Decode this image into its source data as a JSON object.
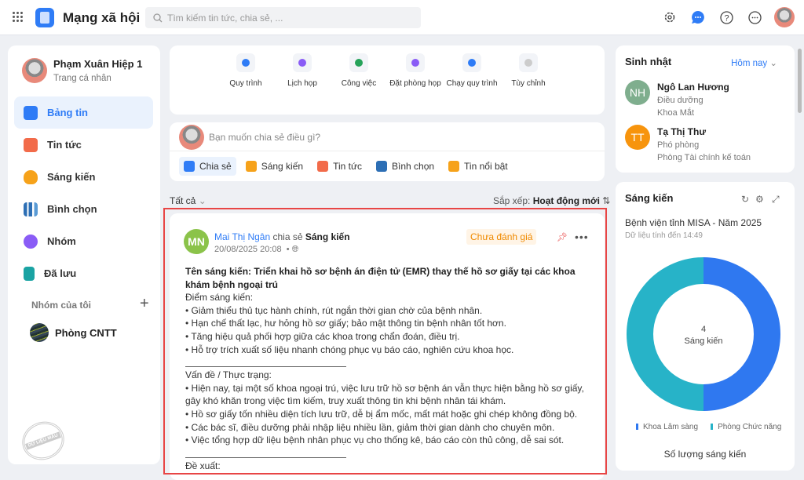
{
  "header": {
    "app_title": "Mạng xã hội",
    "search_placeholder": "Tìm kiếm tin tức, chia sẻ, ..."
  },
  "profile": {
    "name": "Phạm Xuân Hiệp 1",
    "subtitle": "Trang cá nhân"
  },
  "nav": [
    {
      "label": "Bảng tin",
      "color": "#2f7cf6"
    },
    {
      "label": "Tin tức",
      "color": "#f26b4a"
    },
    {
      "label": "Sáng kiến",
      "color": "#f6a21a"
    },
    {
      "label": "Bình chọn",
      "color": "#2d6fb5"
    },
    {
      "label": "Nhóm",
      "color": "#8a5cf6"
    },
    {
      "label": "Đã lưu",
      "color": "#1aa3a3"
    }
  ],
  "groups": {
    "heading": "Nhóm của tôi",
    "items": [
      "Phòng CNTT"
    ]
  },
  "watermark": "DỮ LIỆU MẪU",
  "shortcuts": [
    {
      "label": "Quy trình",
      "color": "#2f7cf6"
    },
    {
      "label": "Lịch họp",
      "color": "#8a5cf6"
    },
    {
      "label": "Công việc",
      "color": "#27a35a"
    },
    {
      "label": "Đặt phòng họp",
      "color": "#8a5cf6"
    },
    {
      "label": "Chạy quy trình",
      "color": "#2f7cf6"
    },
    {
      "label": "Tùy chỉnh",
      "color": "#ccc"
    }
  ],
  "composer": {
    "placeholder": "Bạn muốn chia sẻ điều gì?",
    "actions": [
      {
        "label": "Chia sẻ",
        "color": "#2f7cf6"
      },
      {
        "label": "Sáng kiến",
        "color": "#f6a21a"
      },
      {
        "label": "Tin tức",
        "color": "#f26b4a"
      },
      {
        "label": "Bình chọn",
        "color": "#2d6fb5"
      },
      {
        "label": "Tin nổi bật",
        "color": "#f6a21a"
      }
    ]
  },
  "feed": {
    "filter": "Tất cả",
    "sort_label": "Sắp xếp:",
    "sort_value": "Hoạt động mới"
  },
  "post": {
    "initials": "MN",
    "author": "Mai Thị Ngân",
    "verb": "chia sẻ",
    "type": "Sáng kiến",
    "time": "20/08/2025 20:08",
    "status": "Chưa đánh giá",
    "title": "Tên sáng kiến: Triển khai hồ sơ bệnh án điện tử (EMR) thay thế hồ sơ giấy tại các khoa khám bệnh ngoại trú",
    "points_heading": "Điểm sáng kiến:",
    "points": [
      "• Giảm thiểu thủ tục hành chính, rút ngắn thời gian chờ của bệnh nhân.",
      "• Hạn chế thất lạc, hư hỏng hồ sơ giấy; bảo mật thông tin bệnh nhân tốt hơn.",
      "• Tăng hiệu quả phối hợp giữa các khoa trong chẩn đoán, điều trị.",
      "• Hỗ trợ trích xuất số liệu nhanh chóng phục vụ báo cáo, nghiên cứu khoa học."
    ],
    "issues_heading": "Vấn đề / Thực trạng:",
    "issues": [
      "• Hiện nay, tại một số khoa ngoại trú, việc lưu trữ hồ sơ bệnh án vẫn thực hiện bằng hồ sơ giấy, gây khó khăn trong việc tìm kiếm, truy xuất thông tin khi bệnh nhân tái khám.",
      "• Hồ sơ giấy tốn nhiều diện tích lưu trữ, dễ bị ẩm mốc, mất mát hoặc ghi chép không đồng bộ.",
      "• Các bác sĩ, điều dưỡng phải nhập liệu nhiều lần, giảm thời gian dành cho chuyên môn.",
      "• Việc tổng hợp dữ liệu bệnh nhân phục vụ cho thống kê, báo cáo còn thủ công, dễ sai sót."
    ],
    "proposal_heading": "Đề xuất:"
  },
  "birthday": {
    "title": "Sinh nhật",
    "filter": "Hôm nay",
    "people": [
      {
        "initials": "NH",
        "name": "Ngô Lan Hương",
        "role": "Điều dưỡng",
        "dept": "Khoa Mắt",
        "color": "#7fae8e"
      },
      {
        "initials": "TT",
        "name": "Tạ Thị Thư",
        "role": "Phó phòng",
        "dept": "Phòng Tài chính kế toán",
        "color": "#f7940d"
      }
    ]
  },
  "initiative": {
    "title": "Sáng kiến",
    "org": "Bệnh viện tỉnh MISA - Năm 2025",
    "as_of": "Dữ liệu tính đến 14:49"
  },
  "chart_data": {
    "type": "pie",
    "title": "Số lượng sáng kiến",
    "center_value": "4",
    "center_label": "Sáng kiến",
    "categories": [
      "Khoa Lâm sàng",
      "Phòng Chức năng"
    ],
    "values": [
      2,
      2
    ],
    "colors": [
      "#2f78f0",
      "#27b3c8"
    ],
    "legend": "bottom"
  }
}
